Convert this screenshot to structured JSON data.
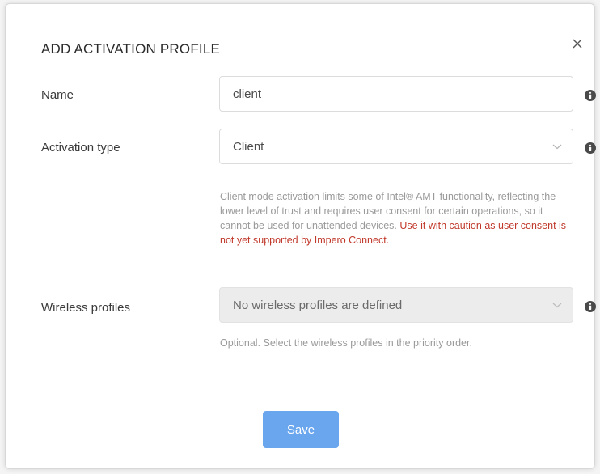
{
  "dialog": {
    "title": "ADD ACTIVATION PROFILE",
    "close_icon": "close-icon"
  },
  "form": {
    "name": {
      "label": "Name",
      "value": "client",
      "info_icon": "info-icon"
    },
    "activation_type": {
      "label": "Activation type",
      "value": "Client",
      "info_icon": "info-icon",
      "help_text": "Client mode activation limits some of Intel® AMT functionality, reflecting the lower level of trust and requires user consent for certain operations, so it cannot be used for unattended devices.",
      "warning_text": "Use it with caution as user consent is not yet supported by Impero Connect."
    },
    "wireless_profiles": {
      "label": "Wireless profiles",
      "value": "No wireless profiles are defined",
      "info_icon": "info-icon",
      "help_text": "Optional. Select the wireless profiles in the priority order."
    }
  },
  "actions": {
    "save_label": "Save"
  },
  "colors": {
    "accent": "#6aa6ee",
    "warning": "#c0392b",
    "help": "#9a9a9a"
  }
}
